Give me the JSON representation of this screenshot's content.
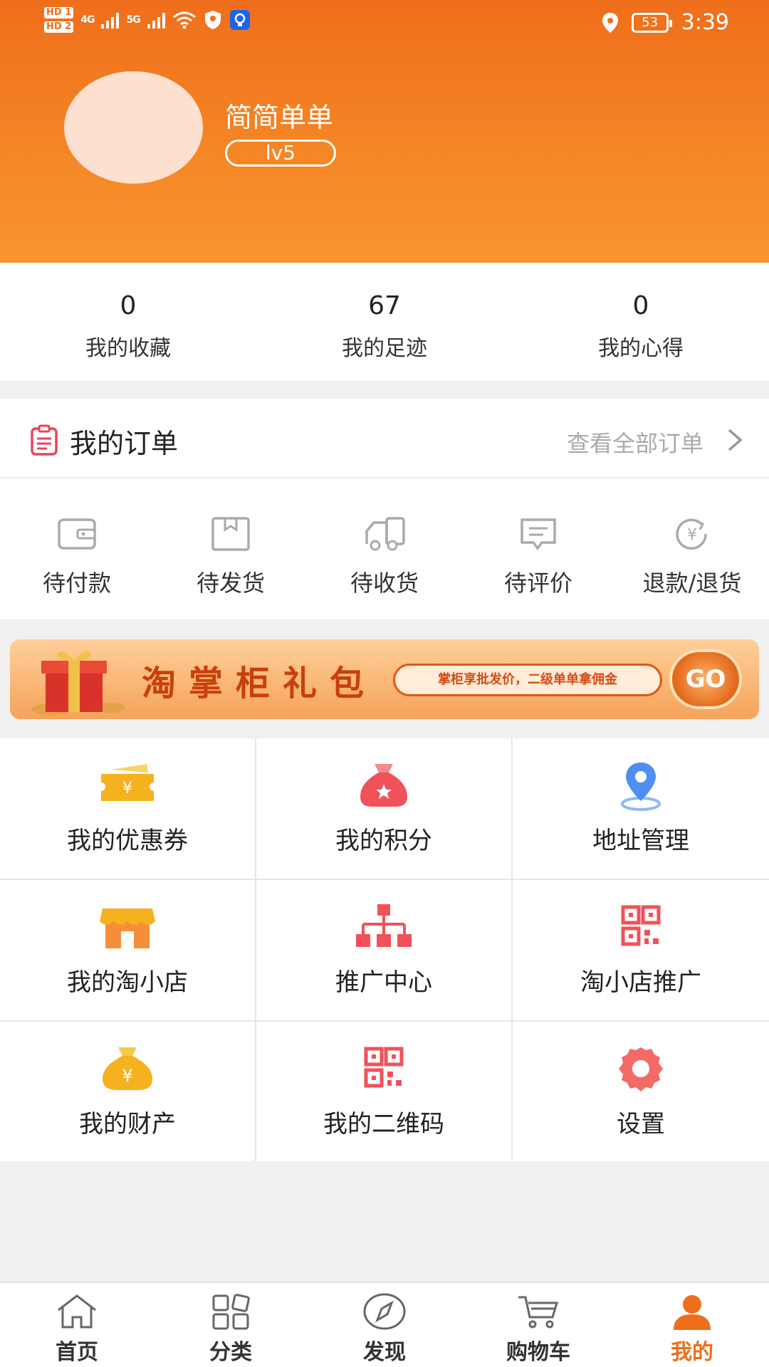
{
  "status_bar": {
    "time": "3:39",
    "battery": "53",
    "sim1": "HD 1",
    "sim2": "HD 2",
    "net1": "4G",
    "net2": "5G"
  },
  "profile": {
    "username": "简简单单",
    "level": "lv5"
  },
  "stats": [
    {
      "value": "0",
      "label": "我的收藏"
    },
    {
      "value": "67",
      "label": "我的足迹"
    },
    {
      "value": "0",
      "label": "我的心得"
    }
  ],
  "orders": {
    "title": "我的订单",
    "view_all": "查看全部订单",
    "items": [
      {
        "label": "待付款",
        "icon": "wallet-icon"
      },
      {
        "label": "待发货",
        "icon": "package-icon"
      },
      {
        "label": "待收货",
        "icon": "truck-icon"
      },
      {
        "label": "待评价",
        "icon": "comment-icon"
      },
      {
        "label": "退款/退货",
        "icon": "refund-icon"
      }
    ]
  },
  "banner": {
    "title": "淘掌柜礼包",
    "subtitle": "掌柜享批发价，二级单单拿佣金",
    "go": "GO"
  },
  "menu": [
    {
      "label": "我的优惠券",
      "icon": "coupon-icon"
    },
    {
      "label": "我的积分",
      "icon": "points-bag-icon"
    },
    {
      "label": "地址管理",
      "icon": "location-pin-icon"
    },
    {
      "label": "我的淘小店",
      "icon": "shop-icon"
    },
    {
      "label": "推广中心",
      "icon": "hierarchy-icon"
    },
    {
      "label": "淘小店推广",
      "icon": "qrcode-icon"
    },
    {
      "label": "我的财产",
      "icon": "money-bag-icon"
    },
    {
      "label": "我的二维码",
      "icon": "qrcode-icon"
    },
    {
      "label": "设置",
      "icon": "gear-icon"
    }
  ],
  "tabs": [
    {
      "label": "首页",
      "icon": "home-icon"
    },
    {
      "label": "分类",
      "icon": "category-icon"
    },
    {
      "label": "发现",
      "icon": "compass-icon"
    },
    {
      "label": "购物车",
      "icon": "cart-icon"
    },
    {
      "label": "我的",
      "icon": "user-icon"
    }
  ],
  "colors": {
    "brand_orange": "#ef6e1b",
    "menu_red": "#f0525a",
    "menu_gold": "#f6b21e",
    "location_blue": "#4f8ff0"
  }
}
